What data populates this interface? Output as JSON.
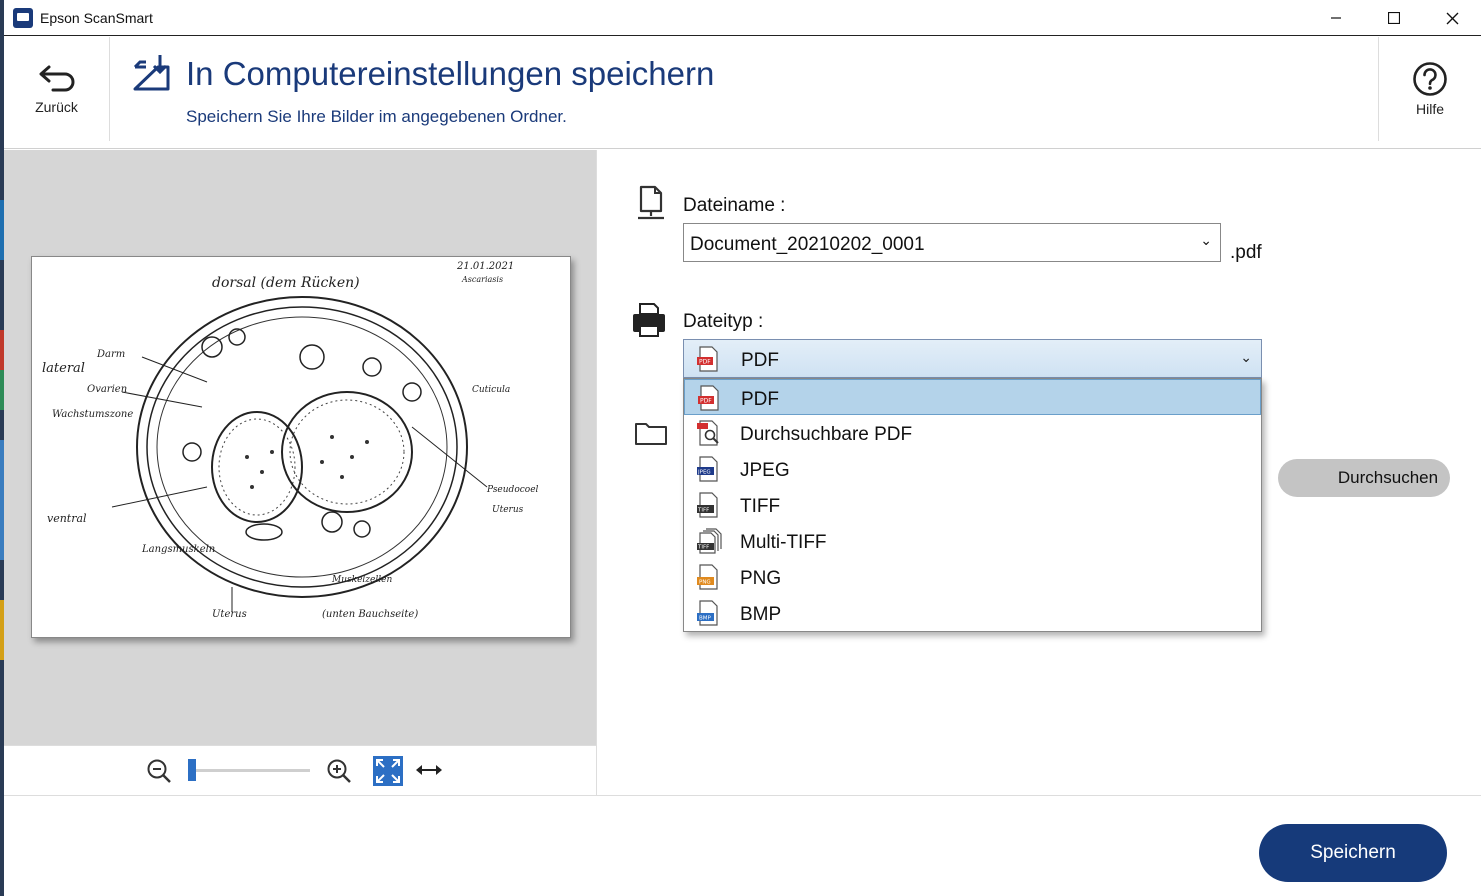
{
  "window": {
    "title": "Epson ScanSmart"
  },
  "header": {
    "back_label": "Zurück",
    "title": "In Computereinstellungen speichern",
    "subtitle": "Speichern Sie Ihre Bilder im angegebenen Ordner.",
    "help_label": "Hilfe"
  },
  "preview": {
    "zoom_level": 0.0
  },
  "form": {
    "filename_label": "Dateiname :",
    "filename_value": "Document_20210202_0001",
    "filename_ext": ".pdf",
    "filetype_label": "Dateityp :",
    "filetype_selected": "PDF",
    "filetype_options": [
      "PDF",
      "Durchsuchbare PDF",
      "JPEG",
      "TIFF",
      "Multi-TIFF",
      "PNG",
      "BMP"
    ],
    "browse_label": "Durchsuchen"
  },
  "footer": {
    "save_label": "Speichern"
  },
  "colors": {
    "accent": "#163a7a",
    "title_text": "#1a3a7a",
    "selection": "#b4d3ea",
    "preview_bg": "#d6d6d6"
  },
  "icons": {
    "back": "back-arrow-icon",
    "save_to_folder": "save-to-computer-icon",
    "help": "help-circle-icon",
    "file": "file-icon",
    "printer": "filetype-icon",
    "folder": "folder-icon",
    "zoom_out": "zoom-out-icon",
    "zoom_in": "zoom-in-icon",
    "fit": "fit-to-window-icon",
    "pan": "pan-arrows-icon"
  }
}
